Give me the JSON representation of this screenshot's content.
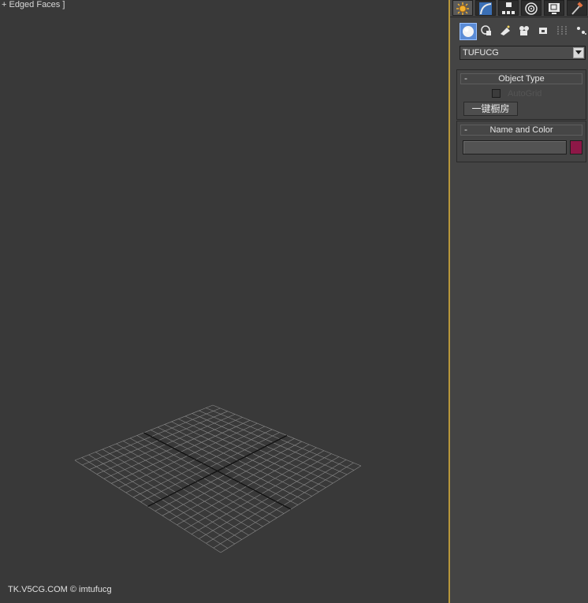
{
  "viewport": {
    "label": "+ Edged Faces ]",
    "watermark": "TK.V5CG.COM © imtufucg"
  },
  "command_panel": {
    "tabs": [
      {
        "name": "create-tab",
        "icon": "sun-star-icon",
        "active": true
      },
      {
        "name": "modify-tab",
        "icon": "modify-arc-icon",
        "active": false
      },
      {
        "name": "hierarchy-tab",
        "icon": "hierarchy-icon",
        "active": false
      },
      {
        "name": "motion-tab",
        "icon": "motion-circle-icon",
        "active": false
      },
      {
        "name": "display-tab",
        "icon": "display-monitor-icon",
        "active": false
      },
      {
        "name": "utilities-tab",
        "icon": "hammer-icon",
        "active": false
      }
    ],
    "categories": [
      {
        "name": "geometry",
        "icon": "sphere-icon",
        "active": true
      },
      {
        "name": "shapes",
        "icon": "shapes-icon"
      },
      {
        "name": "lights",
        "icon": "light-icon"
      },
      {
        "name": "cameras",
        "icon": "camera-icon"
      },
      {
        "name": "helpers",
        "icon": "helper-icon"
      },
      {
        "name": "space-warps",
        "icon": "spacewarp-icon"
      },
      {
        "name": "systems",
        "icon": "systems-icon"
      }
    ],
    "dropdown": {
      "selected": "TUFUCG"
    },
    "object_type": {
      "title": "Object Type",
      "autogrid_label": "AutoGrid",
      "autogrid_checked": false,
      "button_label": "一键橱房"
    },
    "name_and_color": {
      "title": "Name and Color",
      "name_value": "",
      "color": "#8e1747"
    }
  },
  "colors": {
    "viewport_bg": "#393939",
    "panel_bg": "#444444",
    "active_border": "#b8973b",
    "grid_line": "#8a8a8a",
    "grid_axis": "#111111"
  }
}
